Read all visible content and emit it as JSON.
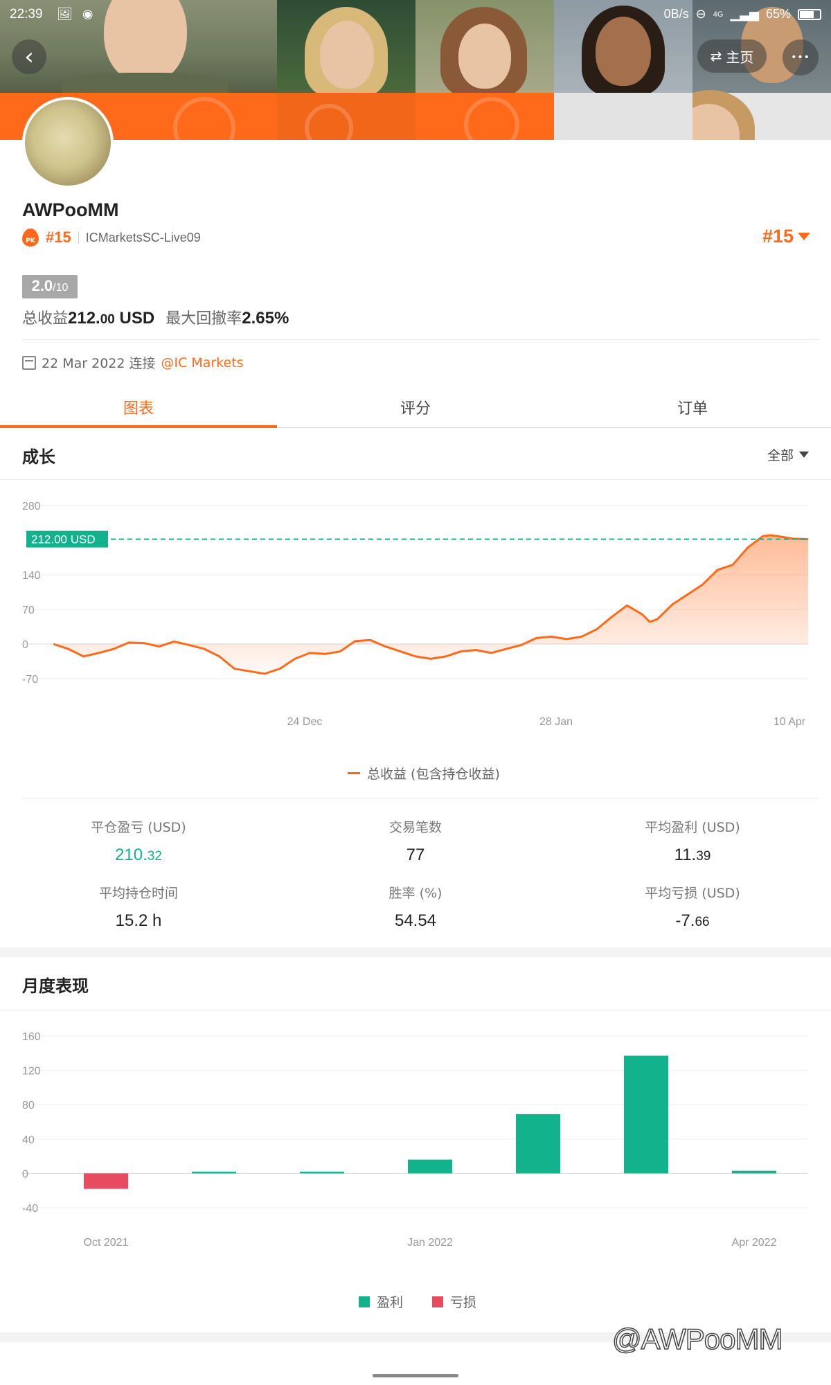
{
  "status_bar": {
    "time": "22:39",
    "net_speed": "0B/s",
    "signal": "4G",
    "battery": "65%"
  },
  "nav": {
    "back_symbol": "‹",
    "home_label": "主页",
    "home_symbol": "⇄",
    "more_symbol": "•••"
  },
  "profile": {
    "name": "AWPooMM",
    "rank": "#15",
    "pk_label": "PK",
    "server": "ICMarketsSC-Live09",
    "rank_right": "#15",
    "score": "2.0",
    "score_max": "/10",
    "total_profit_label": "总收益",
    "total_profit_int": "212.",
    "total_profit_dec": "00",
    "total_profit_unit": " USD",
    "drawdown_label": "最大回撤率",
    "drawdown_value": "2.65%",
    "connect_date": "22 Mar 2022 连接",
    "broker": "@IC Markets"
  },
  "tabs": [
    {
      "label": "图表"
    },
    {
      "label": "评分"
    },
    {
      "label": "订单"
    }
  ],
  "growth": {
    "title": "成长",
    "range_label": "全部",
    "legend": "总收益 (包含持仓收益)",
    "marker_label": "212.00 USD"
  },
  "stats": {
    "closed_pl": {
      "label": "平仓盈亏 (USD)",
      "int": "210.",
      "dec": "32"
    },
    "trades": {
      "label": "交易笔数",
      "value": "77"
    },
    "avg_profit": {
      "label": "平均盈利 (USD)",
      "int": "11.",
      "dec": "39"
    },
    "avg_hold": {
      "label": "平均持仓时间",
      "value": "15.2 h"
    },
    "win_rate": {
      "label": "胜率 (%)",
      "value": "54.54"
    },
    "avg_loss": {
      "label": "平均亏损 (USD)",
      "int": "-7.",
      "dec": "66"
    }
  },
  "monthly": {
    "title": "月度表现",
    "legend_profit": "盈利",
    "legend_loss": "亏损"
  },
  "watermark": "@AWPooMM",
  "colors": {
    "accent": "#ff6a1a",
    "profit": "#12b28c",
    "loss": "#e84a5f"
  },
  "chart_data": [
    {
      "type": "area",
      "title": "成长",
      "series": [
        {
          "name": "总收益 (包含持仓收益)",
          "x": [
            0,
            2,
            4,
            6,
            8,
            10,
            12,
            14,
            16,
            18,
            20,
            22,
            24,
            26,
            28,
            30,
            32,
            34,
            36,
            38,
            40,
            42,
            44,
            46,
            48,
            50,
            52,
            54,
            56,
            58,
            60,
            62,
            64,
            66,
            68,
            70,
            72,
            74,
            76,
            78,
            79,
            80,
            82,
            84,
            86,
            88,
            90,
            92,
            94,
            95,
            96,
            98,
            100
          ],
          "values": [
            0,
            -10,
            -25,
            -18,
            -10,
            3,
            2,
            -5,
            5,
            -2,
            -10,
            -25,
            -50,
            -55,
            -60,
            -50,
            -30,
            -18,
            -20,
            -15,
            6,
            8,
            -5,
            -15,
            -25,
            -30,
            -25,
            -15,
            -12,
            -18,
            -10,
            -2,
            12,
            15,
            10,
            15,
            30,
            55,
            78,
            60,
            45,
            50,
            80,
            100,
            120,
            150,
            160,
            195,
            218,
            220,
            218,
            213,
            212
          ]
        }
      ],
      "x_ticks": [
        "24 Dec",
        "28 Jan",
        "10 Apr"
      ],
      "y_ticks": [
        -70,
        0,
        70,
        140,
        280
      ],
      "ylim": [
        -70,
        280
      ],
      "reference_value": 212,
      "reference_label": "212.00 USD"
    },
    {
      "type": "bar",
      "title": "月度表现",
      "categories": [
        "Oct 2021",
        "Nov 2021",
        "Dec 2021",
        "Jan 2022",
        "Feb 2022",
        "Mar 2022",
        "Apr 2022"
      ],
      "x_tick_labels": [
        "Oct 2021",
        "Jan 2022",
        "Apr 2022"
      ],
      "series": [
        {
          "name": "盈利",
          "values": [
            0,
            2,
            2,
            16,
            69,
            137,
            3
          ]
        },
        {
          "name": "亏损",
          "values": [
            -18,
            0,
            0,
            0,
            0,
            0,
            0
          ]
        }
      ],
      "y_ticks": [
        -40,
        0,
        40,
        80,
        120,
        160
      ],
      "ylim": [
        -40,
        160
      ]
    }
  ]
}
